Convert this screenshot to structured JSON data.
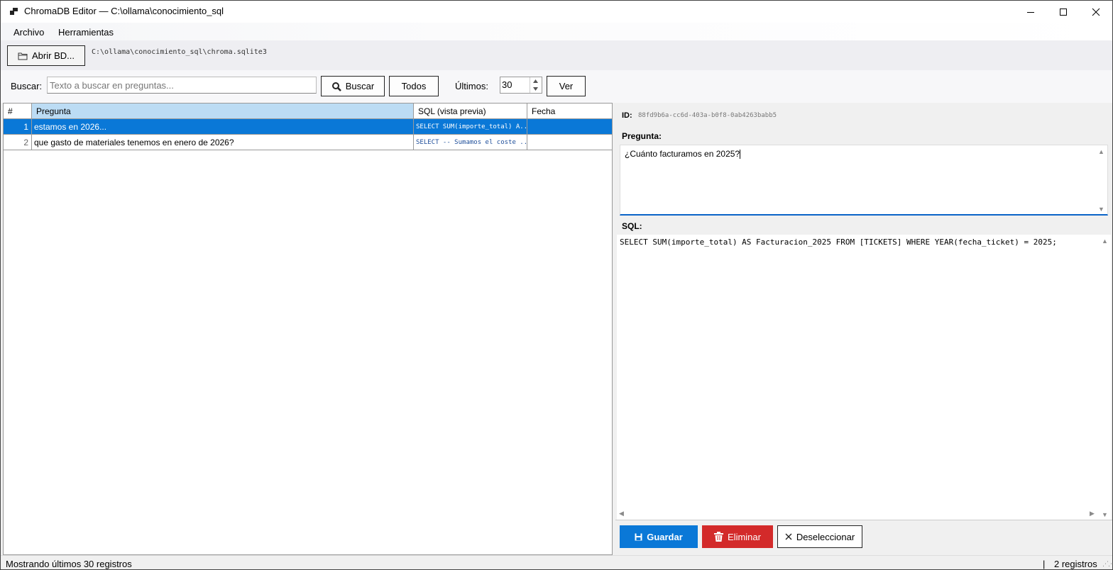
{
  "window": {
    "title": "ChromaDB Editor — C:\\ollama\\conocimiento_sql",
    "minimize_glyph": "—",
    "maximize_glyph": "☐",
    "close_glyph": "✕"
  },
  "menu": {
    "archivo": "Archivo",
    "herramientas": "Herramientas"
  },
  "toolbar": {
    "open_label": "Abrir BD...",
    "db_path": "C:\\ollama\\conocimiento_sql\\chroma.sqlite3"
  },
  "search": {
    "label": "Buscar:",
    "placeholder": "Texto a buscar en preguntas...",
    "value": "",
    "buscar_label": "Buscar",
    "todos_label": "Todos",
    "ultimos_label": "Últimos:",
    "ultimos_value": "30",
    "ver_label": "Ver"
  },
  "table": {
    "headers": {
      "hash": "#",
      "pregunta": "Pregunta",
      "sql": "SQL (vista previa)",
      "fecha": "Fecha"
    },
    "rows": [
      {
        "n": "1",
        "pregunta": "estamos en 2026...",
        "sql": "SELECT SUM(importe_total) A...",
        "fecha": "",
        "selected": true
      },
      {
        "n": "2",
        "pregunta": "que gasto de materiales tenemos en enero de 2026?",
        "sql": "SELECT -- Sumamos el coste ...",
        "fecha": "",
        "selected": false
      }
    ]
  },
  "detail": {
    "id_label": "ID:",
    "id_value": "88fd9b6a-cc6d-403a-b0f8-0ab4263babb5",
    "pregunta_label": "Pregunta:",
    "pregunta_value": "¿Cuánto facturamos en  2025?",
    "sql_label": "SQL:",
    "sql_value": "SELECT SUM(importe_total) AS Facturacion_2025 FROM [TICKETS] WHERE YEAR(fecha_ticket) = 2025;",
    "guardar_label": "Guardar",
    "eliminar_label": "Eliminar",
    "deseleccionar_label": "Deseleccionar"
  },
  "status": {
    "left": "Mostrando últimos 30 registros",
    "separator": "|",
    "right": "2 registros"
  },
  "colors": {
    "accent": "#0a78d7",
    "danger": "#d32a2a",
    "header_selected": "#bcdcf4"
  },
  "icons": [
    "app-icon",
    "folder-icon",
    "search-icon",
    "save-icon",
    "trash-icon",
    "close-icon"
  ]
}
